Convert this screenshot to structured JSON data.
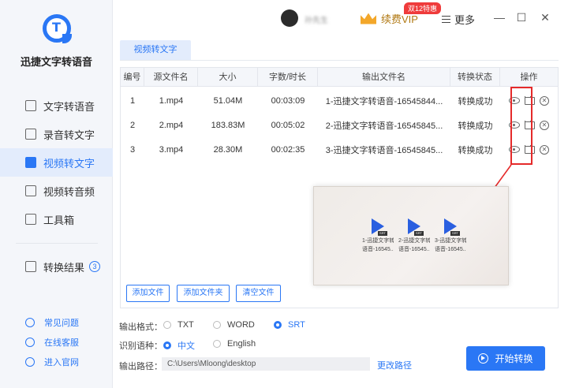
{
  "app": {
    "name": "迅捷文字转语音",
    "logo_letter": "T"
  },
  "nav": {
    "items": [
      {
        "label": "文字转语音",
        "active": false
      },
      {
        "label": "录音转文字",
        "active": false
      },
      {
        "label": "视频转文字",
        "active": true
      },
      {
        "label": "视频转音频",
        "active": false
      },
      {
        "label": "工具箱",
        "active": false
      }
    ],
    "result": {
      "label": "转换结果",
      "count": "3"
    },
    "bottom": [
      {
        "label": "常见问题"
      },
      {
        "label": "在线客服"
      },
      {
        "label": "进入官网"
      }
    ]
  },
  "topbar": {
    "username": "孙先生",
    "vip_label": "续费VIP",
    "vip_tag": "双12特惠",
    "more_label": "更多",
    "minimize": "—",
    "maximize": "☐",
    "close": "✕"
  },
  "tab": {
    "label": "视频转文字"
  },
  "table": {
    "headers": [
      "编号",
      "源文件名",
      "大小",
      "字数/时长",
      "输出文件名",
      "转换状态",
      "操作"
    ],
    "rows": [
      {
        "id": "1",
        "name": "1.mp4",
        "size": "51.04M",
        "duration": "00:03:09",
        "output": "1-迅捷文字转语音-16545844...",
        "status": "转换成功"
      },
      {
        "id": "2",
        "name": "2.mp4",
        "size": "183.83M",
        "duration": "00:05:02",
        "output": "2-迅捷文字转语音-16545845...",
        "status": "转换成功"
      },
      {
        "id": "3",
        "name": "3.mp4",
        "size": "28.30M",
        "duration": "00:02:35",
        "output": "3-迅捷文字转语音-16545845...",
        "status": "转换成功"
      }
    ]
  },
  "preview": {
    "files": [
      {
        "tag": "SRT",
        "line1": "1-迅捷文字转",
        "line2": "语音-16545..."
      },
      {
        "tag": "SRT",
        "line1": "2-迅捷文字转",
        "line2": "语音-16545..."
      },
      {
        "tag": "SRT",
        "line1": "3-迅捷文字转",
        "line2": "语音-16545..."
      }
    ]
  },
  "buttons": {
    "add_file": "添加文件",
    "add_folder": "添加文件夹",
    "clear_files": "清空文件"
  },
  "options": {
    "format_label": "输出格式：",
    "formats": [
      {
        "label": "TXT",
        "selected": false
      },
      {
        "label": "WORD",
        "selected": false
      },
      {
        "label": "SRT",
        "selected": true
      }
    ],
    "language_label": "识别语种：",
    "languages": [
      {
        "label": "中文",
        "selected": true
      },
      {
        "label": "English",
        "selected": false
      }
    ],
    "path_label": "输出路径：",
    "path_value": "C:\\Users\\Mloong\\desktop",
    "change_path": "更改路径"
  },
  "start_button": "开始转换",
  "colors": {
    "accent": "#2a77f5",
    "highlight": "#e52a2a",
    "vip": "#f3a72a"
  }
}
